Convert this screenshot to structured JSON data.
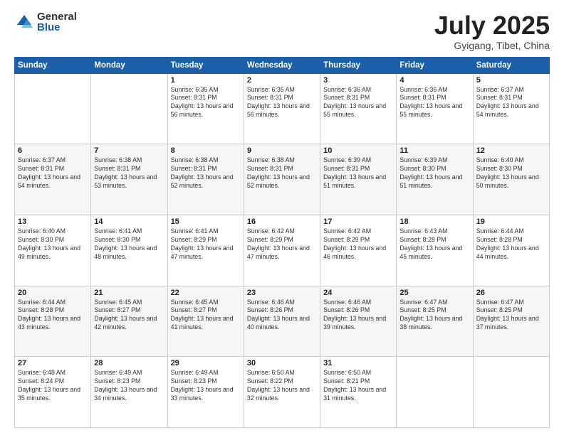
{
  "logo": {
    "general": "General",
    "blue": "Blue"
  },
  "header": {
    "month": "July 2025",
    "location": "Gyigang, Tibet, China"
  },
  "days": [
    "Sunday",
    "Monday",
    "Tuesday",
    "Wednesday",
    "Thursday",
    "Friday",
    "Saturday"
  ],
  "weeks": [
    [
      {
        "day": "",
        "data": ""
      },
      {
        "day": "",
        "data": ""
      },
      {
        "day": "1",
        "data": "Sunrise: 6:35 AM\nSunset: 8:31 PM\nDaylight: 13 hours and 56 minutes."
      },
      {
        "day": "2",
        "data": "Sunrise: 6:35 AM\nSunset: 8:31 PM\nDaylight: 13 hours and 56 minutes."
      },
      {
        "day": "3",
        "data": "Sunrise: 6:36 AM\nSunset: 8:31 PM\nDaylight: 13 hours and 55 minutes."
      },
      {
        "day": "4",
        "data": "Sunrise: 6:36 AM\nSunset: 8:31 PM\nDaylight: 13 hours and 55 minutes."
      },
      {
        "day": "5",
        "data": "Sunrise: 6:37 AM\nSunset: 8:31 PM\nDaylight: 13 hours and 54 minutes."
      }
    ],
    [
      {
        "day": "6",
        "data": "Sunrise: 6:37 AM\nSunset: 8:31 PM\nDaylight: 13 hours and 54 minutes."
      },
      {
        "day": "7",
        "data": "Sunrise: 6:38 AM\nSunset: 8:31 PM\nDaylight: 13 hours and 53 minutes."
      },
      {
        "day": "8",
        "data": "Sunrise: 6:38 AM\nSunset: 8:31 PM\nDaylight: 13 hours and 52 minutes."
      },
      {
        "day": "9",
        "data": "Sunrise: 6:38 AM\nSunset: 8:31 PM\nDaylight: 13 hours and 52 minutes."
      },
      {
        "day": "10",
        "data": "Sunrise: 6:39 AM\nSunset: 8:31 PM\nDaylight: 13 hours and 51 minutes."
      },
      {
        "day": "11",
        "data": "Sunrise: 6:39 AM\nSunset: 8:30 PM\nDaylight: 13 hours and 51 minutes."
      },
      {
        "day": "12",
        "data": "Sunrise: 6:40 AM\nSunset: 8:30 PM\nDaylight: 13 hours and 50 minutes."
      }
    ],
    [
      {
        "day": "13",
        "data": "Sunrise: 6:40 AM\nSunset: 8:30 PM\nDaylight: 13 hours and 49 minutes."
      },
      {
        "day": "14",
        "data": "Sunrise: 6:41 AM\nSunset: 8:30 PM\nDaylight: 13 hours and 48 minutes."
      },
      {
        "day": "15",
        "data": "Sunrise: 6:41 AM\nSunset: 8:29 PM\nDaylight: 13 hours and 47 minutes."
      },
      {
        "day": "16",
        "data": "Sunrise: 6:42 AM\nSunset: 8:29 PM\nDaylight: 13 hours and 47 minutes."
      },
      {
        "day": "17",
        "data": "Sunrise: 6:42 AM\nSunset: 8:29 PM\nDaylight: 13 hours and 46 minutes."
      },
      {
        "day": "18",
        "data": "Sunrise: 6:43 AM\nSunset: 8:28 PM\nDaylight: 13 hours and 45 minutes."
      },
      {
        "day": "19",
        "data": "Sunrise: 6:44 AM\nSunset: 8:28 PM\nDaylight: 13 hours and 44 minutes."
      }
    ],
    [
      {
        "day": "20",
        "data": "Sunrise: 6:44 AM\nSunset: 8:28 PM\nDaylight: 13 hours and 43 minutes."
      },
      {
        "day": "21",
        "data": "Sunrise: 6:45 AM\nSunset: 8:27 PM\nDaylight: 13 hours and 42 minutes."
      },
      {
        "day": "22",
        "data": "Sunrise: 6:45 AM\nSunset: 8:27 PM\nDaylight: 13 hours and 41 minutes."
      },
      {
        "day": "23",
        "data": "Sunrise: 6:46 AM\nSunset: 8:26 PM\nDaylight: 13 hours and 40 minutes."
      },
      {
        "day": "24",
        "data": "Sunrise: 6:46 AM\nSunset: 8:26 PM\nDaylight: 13 hours and 39 minutes."
      },
      {
        "day": "25",
        "data": "Sunrise: 6:47 AM\nSunset: 8:25 PM\nDaylight: 13 hours and 38 minutes."
      },
      {
        "day": "26",
        "data": "Sunrise: 6:47 AM\nSunset: 8:25 PM\nDaylight: 13 hours and 37 minutes."
      }
    ],
    [
      {
        "day": "27",
        "data": "Sunrise: 6:48 AM\nSunset: 8:24 PM\nDaylight: 13 hours and 35 minutes."
      },
      {
        "day": "28",
        "data": "Sunrise: 6:49 AM\nSunset: 8:23 PM\nDaylight: 13 hours and 34 minutes."
      },
      {
        "day": "29",
        "data": "Sunrise: 6:49 AM\nSunset: 8:23 PM\nDaylight: 13 hours and 33 minutes."
      },
      {
        "day": "30",
        "data": "Sunrise: 6:50 AM\nSunset: 8:22 PM\nDaylight: 13 hours and 32 minutes."
      },
      {
        "day": "31",
        "data": "Sunrise: 6:50 AM\nSunset: 8:21 PM\nDaylight: 13 hours and 31 minutes."
      },
      {
        "day": "",
        "data": ""
      },
      {
        "day": "",
        "data": ""
      }
    ]
  ]
}
